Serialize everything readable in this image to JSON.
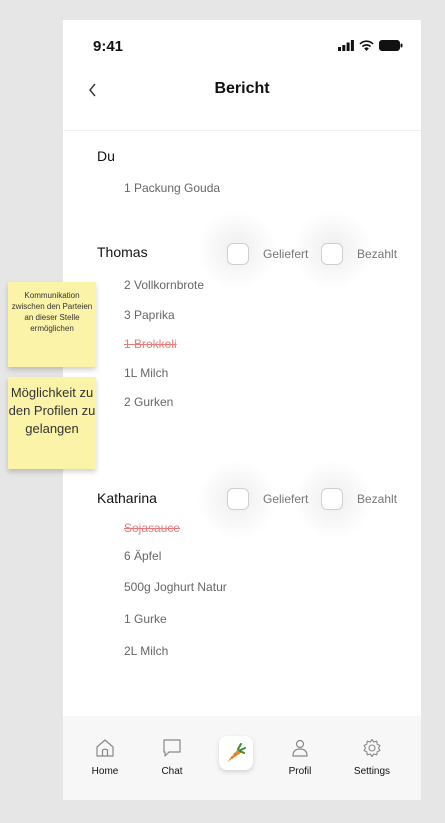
{
  "status": {
    "time": "9:41"
  },
  "header": {
    "title": "Bericht"
  },
  "sections": [
    {
      "name": "Du",
      "items": [
        {
          "text": "1 Packung Gouda",
          "struck": false
        }
      ]
    },
    {
      "name": "Thomas",
      "delivered_label": "Geliefert",
      "paid_label": "Bezahlt",
      "items": [
        {
          "text": "2 Vollkornbrote",
          "struck": false
        },
        {
          "text": "3 Paprika",
          "struck": false
        },
        {
          "text": "1 Brokkoli",
          "struck": true
        },
        {
          "text": "1L Milch",
          "struck": false
        },
        {
          "text": "2 Gurken",
          "struck": false
        }
      ]
    },
    {
      "name": "Katharina",
      "delivered_label": "Geliefert",
      "paid_label": "Bezahlt",
      "items": [
        {
          "text": "Sojasauce",
          "struck": true
        },
        {
          "text": "6 Äpfel",
          "struck": false
        },
        {
          "text": "500g Joghurt Natur",
          "struck": false
        },
        {
          "text": "1 Gurke",
          "struck": false
        },
        {
          "text": "2L Milch",
          "struck": false
        }
      ]
    }
  ],
  "nav": {
    "home": "Home",
    "chat": "Chat",
    "center_icon": "carrot-icon",
    "profile": "Profil",
    "settings": "Settings"
  },
  "annotations": {
    "note1": "Kommunikation zwischen den Parteien an dieser Stelle ermöglichen",
    "note2": "Möglichkeit zu den Profilen zu gelangen"
  },
  "colors": {
    "struck": "#e77b7b",
    "sticky": "#fbf3a7",
    "carrot": "#f0892b"
  }
}
